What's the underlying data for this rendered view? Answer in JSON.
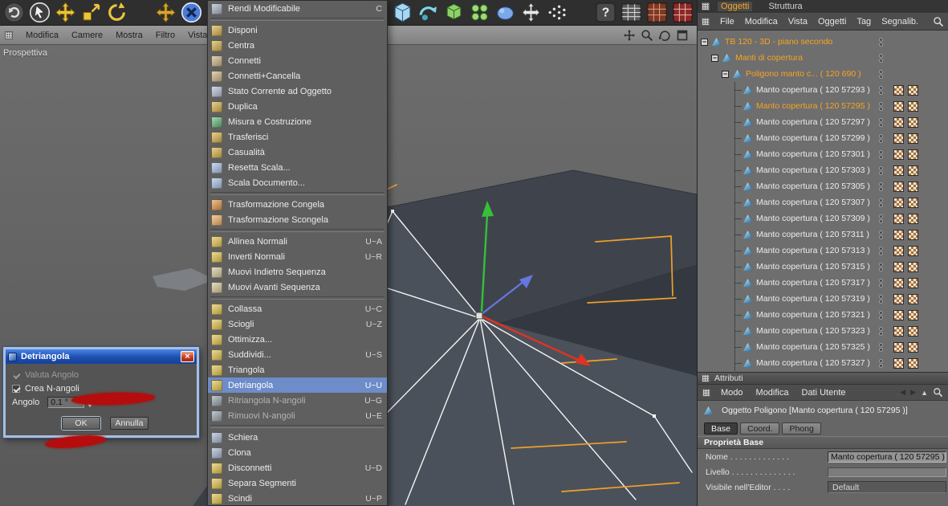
{
  "colors": {
    "accent_orange": "#f7a421",
    "menu_highlight": "#6d8cc9",
    "scribble_red": "#b50d0d",
    "axis_x": "#e03222",
    "axis_y": "#35c03a",
    "axis_z": "#6677e0"
  },
  "toolbar": {
    "left_icons": [
      "undo",
      "live-selection",
      "move-tool",
      "scale-tool",
      "rotate-tool",
      "coordinate-axes",
      "axis-lock-x"
    ],
    "main_icons": [
      "primitive-cube",
      "modeling",
      "add-green-cube",
      "array-spheres",
      "metaball",
      "deformer",
      "particles",
      "help",
      "structure-table",
      "material-grid-a",
      "material-grid-b"
    ]
  },
  "viewport": {
    "menu": [
      "Modifica",
      "Camere",
      "Mostra",
      "Filtro",
      "Vista"
    ],
    "controls": [
      "pan-view",
      "zoom-view",
      "rotate-view",
      "maximize-view"
    ],
    "label": "Prospettiva"
  },
  "context_menu": {
    "items": [
      {
        "label": "Rendi Modificabile",
        "shortcut": "C",
        "icon": "make-editable",
        "color": "#9aa6b4"
      },
      {
        "sep": true
      },
      {
        "label": "Disponi",
        "icon": "arrange",
        "color": "#c9a43c"
      },
      {
        "label": "Centra",
        "icon": "center",
        "color": "#c9a43c"
      },
      {
        "label": "Connetti",
        "icon": "connect",
        "color": "#c0a878"
      },
      {
        "label": "Connetti+Cancella",
        "icon": "connect-delete",
        "color": "#c0a878"
      },
      {
        "label": "Stato Corrente ad Oggetto",
        "icon": "current-state-to-object",
        "color": "#a8b2c4"
      },
      {
        "label": "Duplica",
        "icon": "duplicate",
        "color": "#c9a43c"
      },
      {
        "label": "Misura e Costruzione",
        "icon": "measure",
        "color": "#5aa86a"
      },
      {
        "label": "Trasferisci",
        "icon": "transfer",
        "color": "#c9a43c"
      },
      {
        "label": "Casualità",
        "icon": "randomize",
        "color": "#c9a43c"
      },
      {
        "label": "Resetta Scala...",
        "icon": "reset-scale",
        "color": "#9cb2d6"
      },
      {
        "label": "Scala Documento...",
        "icon": "scale-document",
        "color": "#9cb2d6"
      },
      {
        "sep": true
      },
      {
        "label": "Trasformazione Congela",
        "icon": "freeze-transformation",
        "color": "#d4883a"
      },
      {
        "label": "Trasformazione Scongela",
        "icon": "unfreeze-transformation",
        "color": "#e0a05a"
      },
      {
        "sep": true
      },
      {
        "label": "Allinea Normali",
        "shortcut": "U~A",
        "icon": "align-normals",
        "color": "#d6b83e"
      },
      {
        "label": "Inverti Normali",
        "shortcut": "U~R",
        "icon": "reverse-normals",
        "color": "#d6b83e"
      },
      {
        "label": "Muovi Indietro Sequenza",
        "icon": "move-back-sequence",
        "color": "#cabc8e"
      },
      {
        "label": "Muovi Avanti Sequenza",
        "icon": "move-forward-sequence",
        "color": "#cabc8e"
      },
      {
        "sep": true
      },
      {
        "label": "Collassa",
        "shortcut": "U~C",
        "icon": "collapse",
        "color": "#d6b83e"
      },
      {
        "label": "Sciogli",
        "shortcut": "U~Z",
        "icon": "melt",
        "color": "#d6b83e"
      },
      {
        "label": "Ottimizza...",
        "icon": "optimize",
        "color": "#d6b83e"
      },
      {
        "label": "Suddividi...",
        "shortcut": "U~S",
        "icon": "subdivide",
        "color": "#d6b83e"
      },
      {
        "label": "Triangola",
        "icon": "triangulate",
        "color": "#d6b83e"
      },
      {
        "label": "Detriangola",
        "shortcut": "U~U",
        "icon": "untriangulate",
        "color": "#d6b83e",
        "highlight": true
      },
      {
        "label": "Ritriangola N-angoli",
        "shortcut": "U~G",
        "icon": "retriangulate-ngons",
        "color": "#8a949e",
        "disabled": true
      },
      {
        "label": "Rimuovi N-angoli",
        "shortcut": "U~E",
        "icon": "remove-ngons",
        "color": "#8a949e",
        "disabled": true
      },
      {
        "sep": true
      },
      {
        "label": "Schiera",
        "icon": "array",
        "color": "#9aa8c0"
      },
      {
        "label": "Clona",
        "icon": "clone",
        "color": "#9aa8c0"
      },
      {
        "label": "Disconnetti",
        "shortcut": "U~D",
        "icon": "disconnect",
        "color": "#d6b83e"
      },
      {
        "label": "Separa Segmenti",
        "icon": "split-segments",
        "color": "#d6b83e"
      },
      {
        "label": "Scindi",
        "shortcut": "U~P",
        "icon": "split",
        "color": "#d6b83e"
      }
    ]
  },
  "dialog": {
    "title": "Detriangola",
    "option1": "Valuta Angolo",
    "option2": "Crea N-angoli",
    "angle_label": "Angolo",
    "angle_value": "0.1 °",
    "ok": "OK",
    "cancel": "Annulla"
  },
  "object_manager": {
    "tabs": [
      {
        "label": "Oggetti",
        "active": true
      },
      {
        "label": "Struttura",
        "active": false
      }
    ],
    "menu": [
      "File",
      "Modifica",
      "Vista",
      "Oggetti",
      "Tag",
      "Segnalib."
    ],
    "tree": [
      {
        "label": "TB 120 - 3D - piano secondo",
        "level": 0,
        "orange": true,
        "expander": true,
        "tags": 0
      },
      {
        "label": "Manti di copertura",
        "level": 1,
        "orange": true,
        "expander": true,
        "tags": 0
      },
      {
        "label": "Poligono manto c... ( 120 690 )",
        "level": 2,
        "orange": true,
        "expander": true,
        "tags": 0
      },
      {
        "label": "Manto copertura ( 120 57293 )",
        "level": 3,
        "tags": 2
      },
      {
        "label": "Manto copertura ( 120 57295 )",
        "level": 3,
        "orange": true,
        "selected": true,
        "tags": 2
      },
      {
        "label": "Manto copertura ( 120 57297 )",
        "level": 3,
        "tags": 2
      },
      {
        "label": "Manto copertura ( 120 57299 )",
        "level": 3,
        "tags": 2
      },
      {
        "label": "Manto copertura ( 120 57301 )",
        "level": 3,
        "tags": 2
      },
      {
        "label": "Manto copertura ( 120 57303 )",
        "level": 3,
        "tags": 2
      },
      {
        "label": "Manto copertura ( 120 57305 )",
        "level": 3,
        "tags": 2
      },
      {
        "label": "Manto copertura ( 120 57307 )",
        "level": 3,
        "tags": 2
      },
      {
        "label": "Manto copertura ( 120 57309 )",
        "level": 3,
        "tags": 2
      },
      {
        "label": "Manto copertura ( 120 57311 )",
        "level": 3,
        "tags": 2
      },
      {
        "label": "Manto copertura ( 120 57313 )",
        "level": 3,
        "tags": 2
      },
      {
        "label": "Manto copertura ( 120 57315 )",
        "level": 3,
        "tags": 2
      },
      {
        "label": "Manto copertura ( 120 57317 )",
        "level": 3,
        "tags": 2
      },
      {
        "label": "Manto copertura ( 120 57319 )",
        "level": 3,
        "tags": 2
      },
      {
        "label": "Manto copertura ( 120 57321 )",
        "level": 3,
        "tags": 2
      },
      {
        "label": "Manto copertura ( 120 57323 )",
        "level": 3,
        "tags": 2
      },
      {
        "label": "Manto copertura ( 120 57325 )",
        "level": 3,
        "tags": 2
      },
      {
        "label": "Manto copertura ( 120 57327 )",
        "level": 3,
        "tags": 2
      }
    ]
  },
  "attributes": {
    "header": "Attributi",
    "menu": [
      "Modo",
      "Modifica",
      "Dati Utente"
    ],
    "object_title": "Oggetto Poligono [Manto copertura ( 120 57295 )]",
    "tabs": [
      {
        "label": "Base",
        "active": true
      },
      {
        "label": "Coord.",
        "active": false
      },
      {
        "label": "Phong",
        "active": false
      }
    ],
    "section": "Proprietà Base",
    "fields": [
      {
        "label": "Nome . . . . . . . . . . . . .",
        "type": "input",
        "value": "Manto copertura ( 120 57295 )"
      },
      {
        "label": "Livello . . . . . . . . . . . . . .",
        "type": "empty",
        "value": ""
      },
      {
        "label": "Visibile nell'Editor . . . .",
        "type": "dropdown",
        "value": "Default"
      }
    ]
  }
}
